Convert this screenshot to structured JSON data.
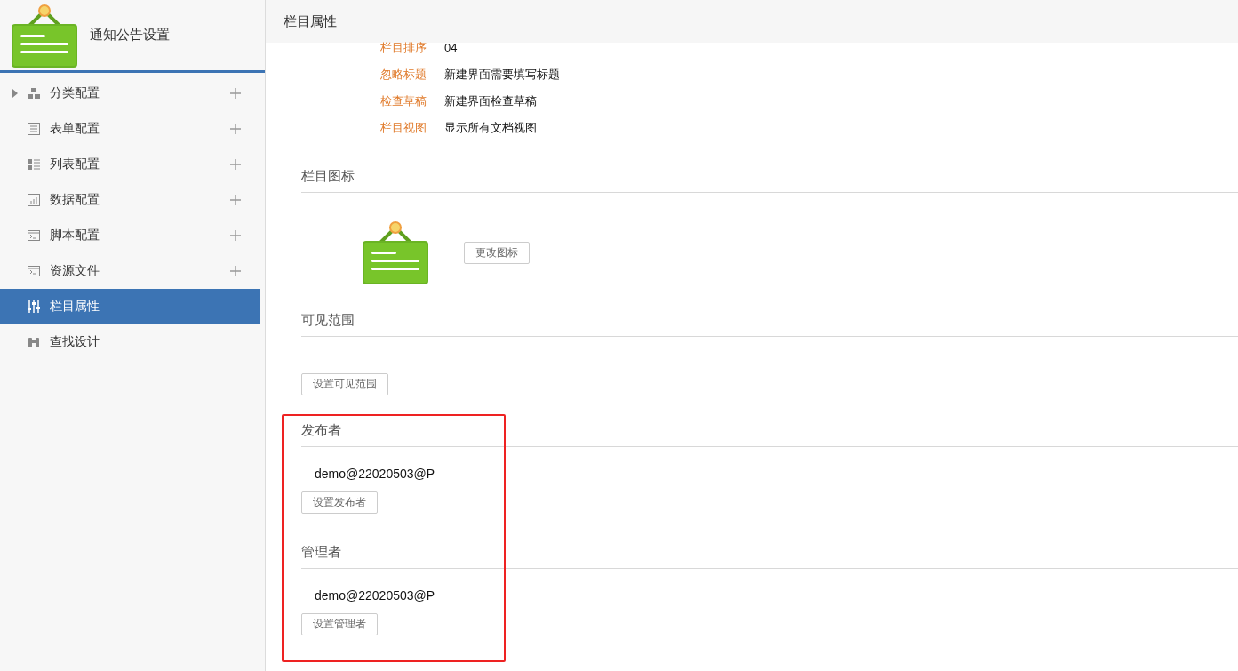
{
  "sidebar": {
    "title": "通知公告设置",
    "items": [
      {
        "label": "分类配置",
        "kind": "blocks",
        "expandable": true,
        "addable": true,
        "selected": false
      },
      {
        "label": "表单配置",
        "kind": "form",
        "expandable": false,
        "addable": true,
        "selected": false
      },
      {
        "label": "列表配置",
        "kind": "list",
        "expandable": false,
        "addable": true,
        "selected": false
      },
      {
        "label": "数据配置",
        "kind": "chart",
        "expandable": false,
        "addable": true,
        "selected": false
      },
      {
        "label": "脚本配置",
        "kind": "console",
        "expandable": false,
        "addable": true,
        "selected": false
      },
      {
        "label": "资源文件",
        "kind": "console",
        "expandable": false,
        "addable": true,
        "selected": false
      },
      {
        "label": "栏目属性",
        "kind": "sliders",
        "expandable": false,
        "addable": false,
        "selected": true
      },
      {
        "label": "查找设计",
        "kind": "binoculars",
        "expandable": false,
        "addable": false,
        "selected": false
      }
    ]
  },
  "header": {
    "title": "栏目属性"
  },
  "properties": [
    {
      "label": "栏目排序",
      "value": "04"
    },
    {
      "label": "忽略标题",
      "value": "新建界面需要填写标题"
    },
    {
      "label": "检查草稿",
      "value": "新建界面检查草稿"
    },
    {
      "label": "栏目视图",
      "value": "显示所有文档视图"
    }
  ],
  "sections": [
    {
      "kind": "icon",
      "title": "栏目图标",
      "button": "更改图标"
    },
    {
      "kind": "scope",
      "title": "可见范围",
      "button": "设置可见范围"
    },
    {
      "kind": "people",
      "title": "发布者",
      "value": "demo@22020503@P",
      "button": "设置发布者"
    },
    {
      "kind": "people",
      "title": "管理者",
      "value": "demo@22020503@P",
      "button": "设置管理者"
    }
  ],
  "annotation": {
    "color": "#ee2222"
  }
}
